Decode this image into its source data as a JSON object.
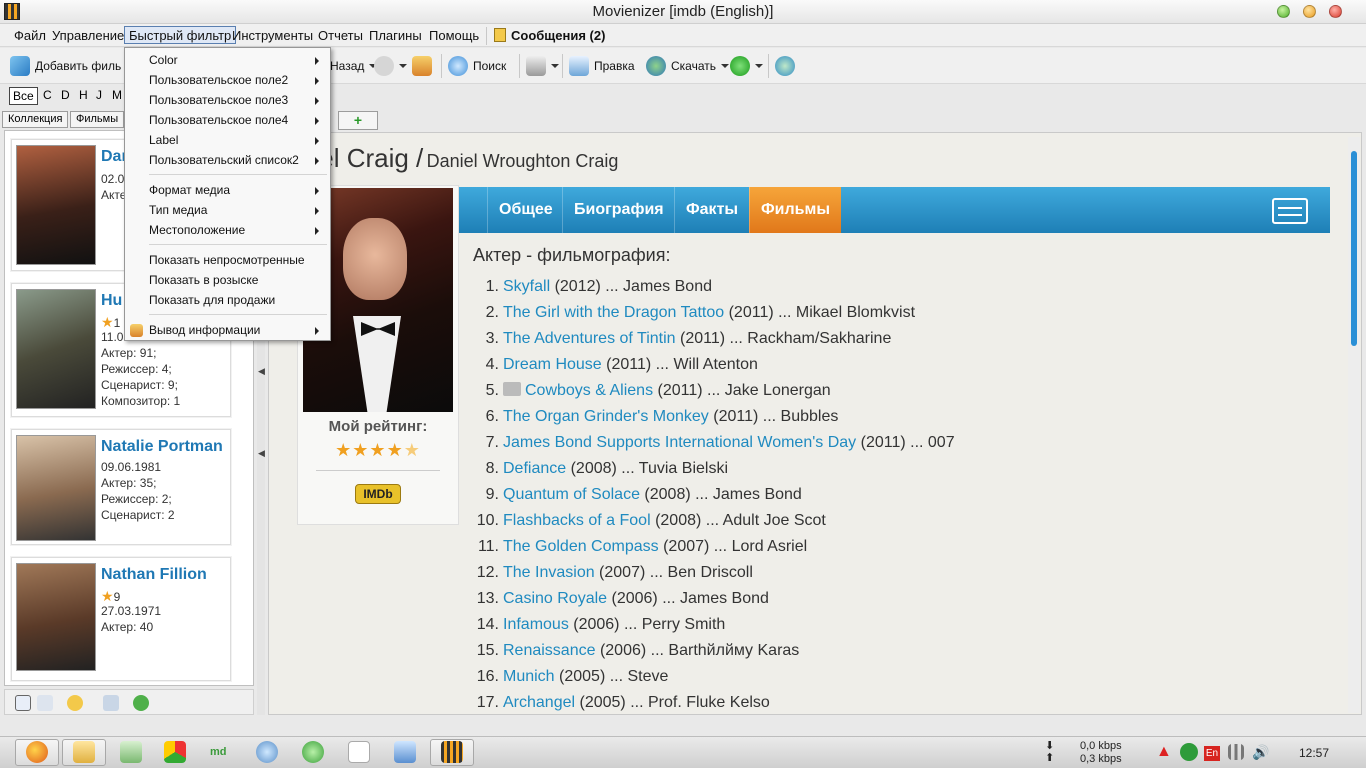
{
  "window": {
    "title": "Movienizer [imdb (English)]"
  },
  "menubar": {
    "items": [
      "Файл",
      "Управление",
      "Быстрый фильтр",
      "Инструменты",
      "Отчеты",
      "Плагины",
      "Помощь"
    ],
    "messages": "Сообщения (2)"
  },
  "toolbar": {
    "add_film": "Добавить филь",
    "back": "Назад",
    "search": "Поиск",
    "edit": "Правка",
    "download": "Скачать"
  },
  "letters": {
    "all": "Все",
    "list": [
      "C",
      "D",
      "H",
      "J",
      "M"
    ]
  },
  "left_tabs": [
    "Коллекция",
    "Фильмы"
  ],
  "people": [
    {
      "name": "Dan",
      "lines": [
        "02.0",
        "Акте"
      ]
    },
    {
      "name": "Hu",
      "rating": "1",
      "lines": [
        "11.0",
        "Актер: 91;",
        "Режиссер: 4;",
        "Сценарист: 9;",
        "Композитор: 1"
      ]
    },
    {
      "name": "Natalie Portman",
      "lines": [
        "09.06.1981",
        "Актер: 35;",
        "Режиссер: 2;",
        "Сценарист: 2"
      ]
    },
    {
      "name": "Nathan Fillion",
      "rating": "9",
      "lines": [
        "27.03.1971",
        "Актер: 40"
      ]
    }
  ],
  "quick_filter_menu": {
    "items": [
      "Color",
      "Пользовательское поле2",
      "Пользовательское поле3",
      "Пользовательское поле4",
      "Label",
      "Пользовательский список2",
      "Формат медиа",
      "Тип медиа",
      "Местоположение",
      "Показать непросмотренные",
      "Показать в розыске",
      "Показать для продажи",
      "Вывод информации"
    ]
  },
  "person_page": {
    "name": "niel Craig /",
    "full_name": "Daniel Wroughton Craig",
    "my_rating_label": "Мой рейтинг:",
    "rating_stars": 4,
    "imdb_label": "IMDb",
    "tabs": [
      "Общее",
      "Биография",
      "Факты",
      "Фильмы"
    ],
    "active_tab": "Фильмы",
    "filmography_title": "Актер - фильмография:",
    "films": [
      {
        "n": "1.",
        "title": "Skyfall",
        "rest": " (2012) ... James Bond"
      },
      {
        "n": "2.",
        "title": "The Girl with the Dragon Tattoo",
        "rest": " (2011) ... Mikael Blomkvist"
      },
      {
        "n": "3.",
        "title": "The Adventures of Tintin",
        "rest": " (2011) ... Rackham/Sakharine"
      },
      {
        "n": "4.",
        "title": "Dream House",
        "rest": " (2011) ... Will Atenton"
      },
      {
        "n": "5.",
        "title": "Cowboys & Aliens",
        "rest": " (2011) ... Jake Lonergan",
        "tv": true
      },
      {
        "n": "6.",
        "title": "The Organ Grinder's Monkey",
        "rest": " (2011) ... Bubbles"
      },
      {
        "n": "7.",
        "title": "James Bond Supports International Women's Day",
        "rest": " (2011) ... 007"
      },
      {
        "n": "8.",
        "title": "Defiance",
        "rest": " (2008) ... Tuvia Bielski"
      },
      {
        "n": "9.",
        "title": "Quantum of Solace",
        "rest": " (2008) ... James Bond"
      },
      {
        "n": "10.",
        "title": "Flashbacks of a Fool",
        "rest": " (2008) ... Adult Joe Scot"
      },
      {
        "n": "11.",
        "title": "The Golden Compass",
        "rest": " (2007) ... Lord Asriel"
      },
      {
        "n": "12.",
        "title": "The Invasion",
        "rest": " (2007) ... Ben Driscoll"
      },
      {
        "n": "13.",
        "title": "Casino Royale",
        "rest": " (2006) ... James Bond"
      },
      {
        "n": "14.",
        "title": "Infamous",
        "rest": " (2006) ... Perry Smith"
      },
      {
        "n": "15.",
        "title": "Renaissance",
        "rest": " (2006) ... Barthйлйму Karas"
      },
      {
        "n": "16.",
        "title": "Munich",
        "rest": " (2005) ... Steve"
      },
      {
        "n": "17.",
        "title": "Archangel",
        "rest": " (2005) ... Prof. Fluke Kelso"
      }
    ]
  },
  "taskbar": {
    "net_down": "0,0 kbps",
    "net_up": "0,3 kbps",
    "lang": "En",
    "clock": "12:57"
  },
  "colors": {
    "accent": "#1f8ac0",
    "nav_blue": "#2a90c6",
    "nav_active": "#ec8a26"
  }
}
